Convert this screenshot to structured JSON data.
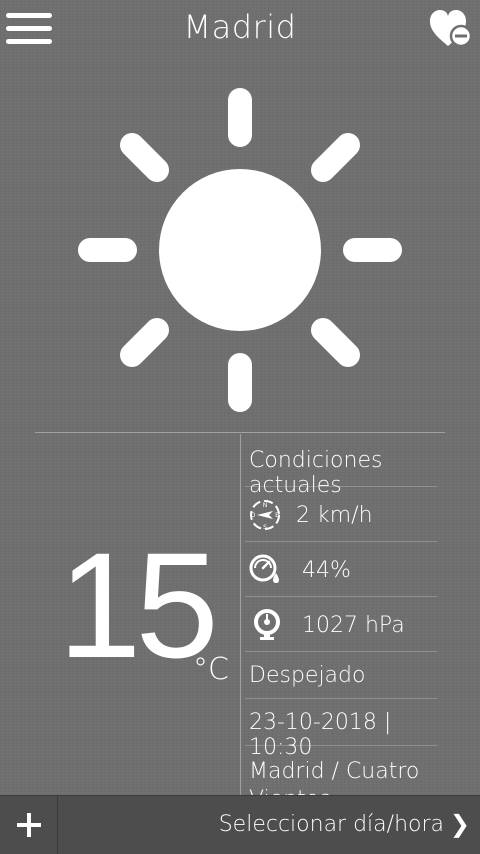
{
  "header": {
    "city": "Madrid",
    "menu_icon": "hamburger-menu-icon",
    "favorite_icon": "heart-minus-icon"
  },
  "weather": {
    "condition_icon": "sun-icon",
    "temperature": "15",
    "unit": "°C"
  },
  "details": {
    "section_title": "Condiciones actuales",
    "wind": {
      "icon": "compass-wind-icon",
      "value": "2 km/h"
    },
    "humidity": {
      "icon": "humidity-gauge-icon",
      "value": "44%"
    },
    "pressure": {
      "icon": "barometer-icon",
      "value": "1027 hPa"
    },
    "description": "Despejado",
    "datetime": "23-10-2018 | 10:30",
    "station": "Madrid / Cuatro Vientos"
  },
  "bottom_bar": {
    "add_icon": "plus-icon",
    "select_label": "Seleccionar día/hora",
    "chevron_icon": "chevron-right-icon"
  },
  "colors": {
    "background": "#6f6f6f",
    "bottom_bar": "#4d4d4d",
    "foreground": "#ffffff"
  }
}
